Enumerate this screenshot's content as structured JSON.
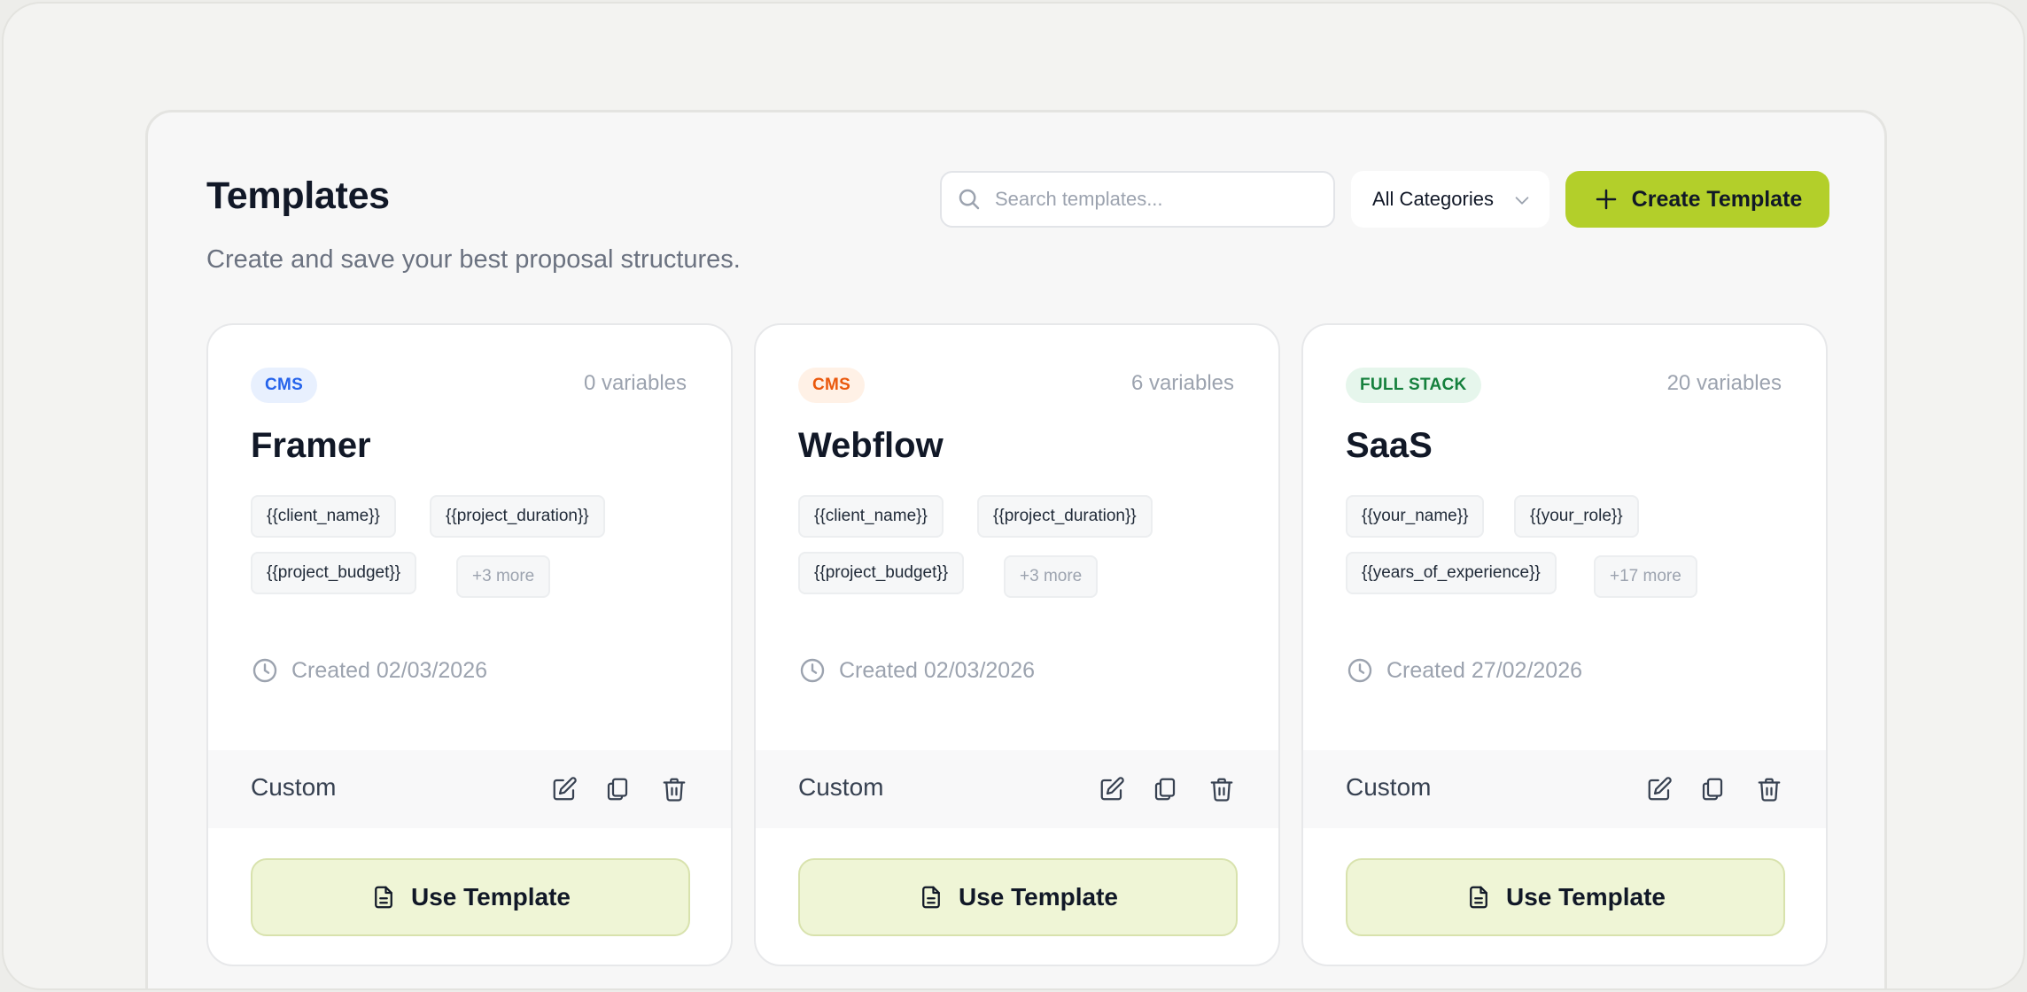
{
  "header": {
    "title": "Templates",
    "subtitle": "Create and save your best proposal structures."
  },
  "search": {
    "placeholder": "Search templates...",
    "value": ""
  },
  "category_filter": {
    "selected": "All Categories"
  },
  "create_button": {
    "label": "Create Template"
  },
  "colors": {
    "accent": "#b3cf2a",
    "use_button_bg": "#eff5d6",
    "badge_blue": "#2563eb",
    "badge_orange": "#ea580c",
    "badge_green": "#15803d"
  },
  "templates": [
    {
      "badge": "CMS",
      "variables": "0 variables",
      "name": "Framer",
      "tags": [
        "{{client_name}}",
        "{{project_duration}}",
        "{{project_budget}}"
      ],
      "more": "+3 more",
      "created": "Created 02/03/2026",
      "footer": "Custom",
      "use_label": "Use Template"
    },
    {
      "badge": "CMS",
      "variables": "6 variables",
      "name": "Webflow",
      "tags": [
        "{{client_name}}",
        "{{project_duration}}",
        "{{project_budget}}"
      ],
      "more": "+3 more",
      "created": "Created 02/03/2026",
      "footer": "Custom",
      "use_label": "Use Template"
    },
    {
      "badge": "FULL STACK",
      "variables": "20 variables",
      "name": "SaaS",
      "tags": [
        "{{your_name}}",
        "{{your_role}}",
        "{{years_of_experience}}"
      ],
      "more": "+17 more",
      "created": "Created 27/02/2026",
      "footer": "Custom",
      "use_label": "Use Template"
    }
  ],
  "icons": {
    "search": "search-icon",
    "chevron": "chevron-down-icon",
    "plus": "plus-icon",
    "clock": "clock-icon",
    "edit": "edit-icon",
    "duplicate": "duplicate-icon",
    "delete": "trash-icon",
    "document": "document-icon"
  }
}
